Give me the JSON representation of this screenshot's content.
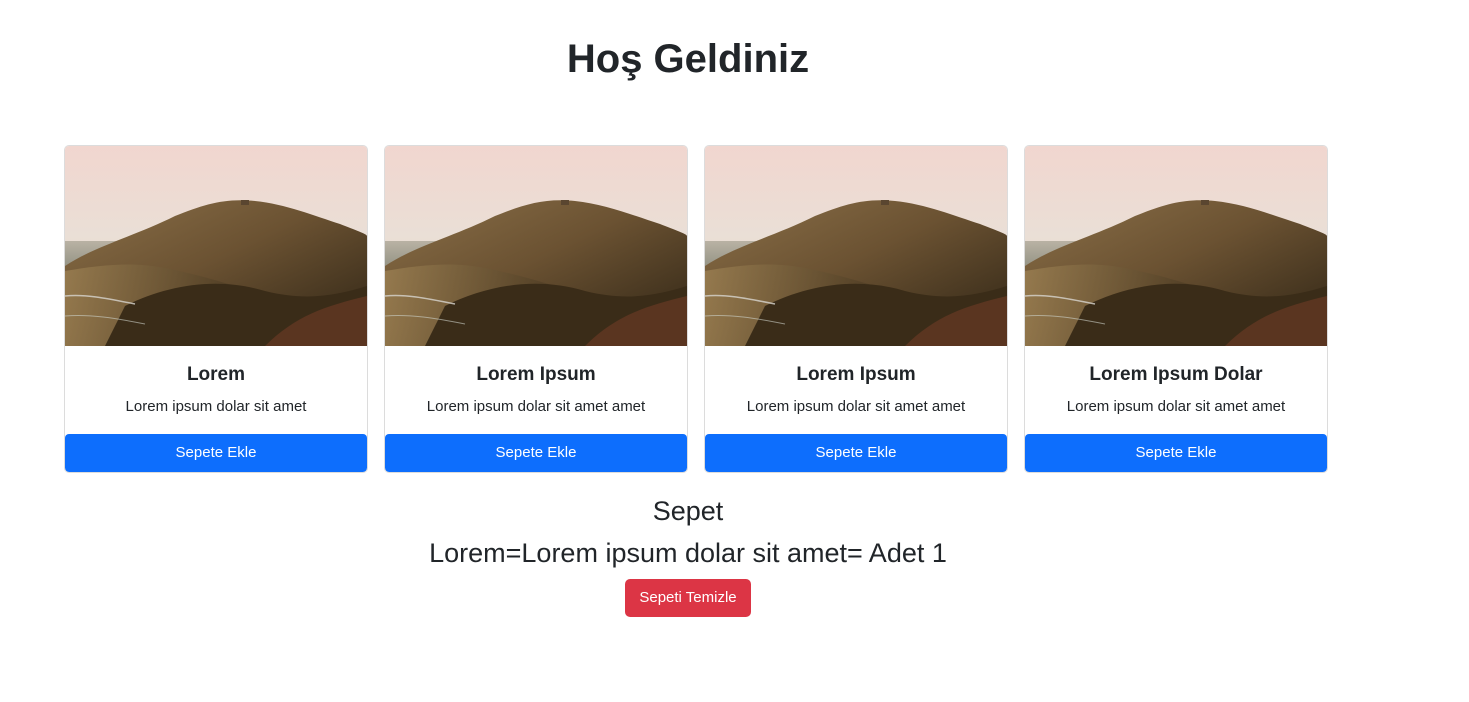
{
  "header": {
    "title": "Hoş Geldiniz"
  },
  "products": [
    {
      "image_alt": "coastal-cliff-sunset",
      "title": "Lorem",
      "description": "Lorem ipsum dolar sit amet",
      "button_label": "Sepete Ekle"
    },
    {
      "image_alt": "coastal-cliff-sunset",
      "title": "Lorem Ipsum",
      "description": "Lorem ipsum dolar sit amet amet",
      "button_label": "Sepete Ekle"
    },
    {
      "image_alt": "coastal-cliff-sunset",
      "title": "Lorem Ipsum",
      "description": "Lorem ipsum dolar sit amet amet",
      "button_label": "Sepete Ekle"
    },
    {
      "image_alt": "coastal-cliff-sunset",
      "title": "Lorem Ipsum Dolar",
      "description": "Lorem ipsum dolar sit amet amet",
      "button_label": "Sepete Ekle"
    }
  ],
  "cart": {
    "title": "Sepet",
    "items": [
      "Lorem=Lorem ipsum dolar sit amet= Adet 1"
    ],
    "clear_label": "Sepeti Temizle"
  },
  "colors": {
    "primary": "#0d6efd",
    "danger": "#dc3545",
    "text": "#212529"
  }
}
